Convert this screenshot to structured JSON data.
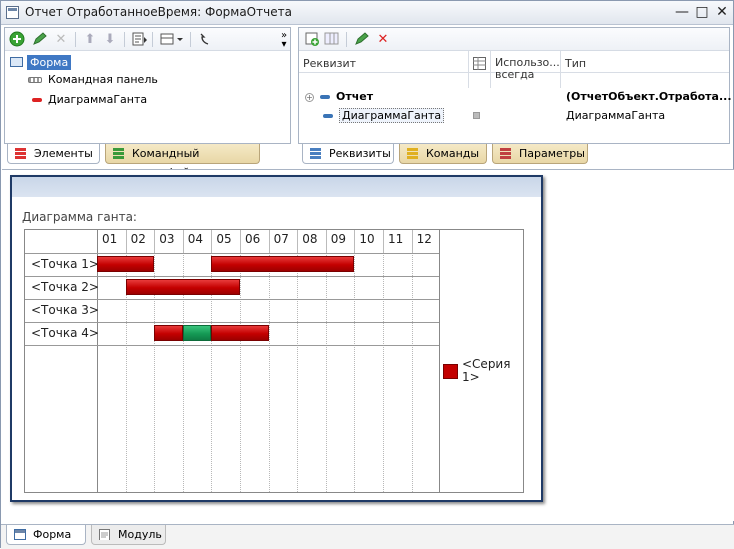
{
  "window": {
    "title": "Отчет ОтработанноеВремя: ФормаОтчета",
    "controls": {
      "minimize": "—",
      "maximize": "□",
      "close": "✕"
    }
  },
  "elements_panel": {
    "toolbar_icons": [
      "add-icon",
      "edit-icon",
      "delete-icon",
      "move-up-icon",
      "move-down-icon",
      "form-view-icon",
      "layout-dropdown-icon",
      "undo-icon",
      "more-icon"
    ],
    "tree": {
      "root": "Форма",
      "children": [
        "Командная панель",
        "ДиаграммаГанта"
      ]
    },
    "tabs": [
      "Элементы",
      "Командный интерфейс"
    ]
  },
  "attributes_panel": {
    "columns": {
      "attribute": "Реквизит",
      "use_always": "Использо... всегда",
      "type": "Тип"
    },
    "rows": [
      {
        "name": "Отчет",
        "type": "(ОтчетОбъект.Отработа..."
      },
      {
        "name": "ДиаграммаГанта",
        "type": "ДиаграммаГанта"
      }
    ],
    "tabs": [
      "Реквизиты",
      "Команды",
      "Параметры"
    ]
  },
  "preview": {
    "caption": "Диаграмма ганта:"
  },
  "chart_data": {
    "type": "gantt",
    "title": "Диаграмма ганта:",
    "periods": [
      "01",
      "02",
      "03",
      "04",
      "05",
      "06",
      "07",
      "08",
      "09",
      "10",
      "11",
      "12"
    ],
    "points": [
      "<Точка 1>",
      "<Точка 2>",
      "<Точка 3>",
      "<Точка 4>"
    ],
    "series": [
      {
        "name": "<Серия 1>",
        "color": "#c30000",
        "intervals": [
          {
            "point": "<Точка 1>",
            "start": 1,
            "end": 3,
            "color": "#c30000"
          },
          {
            "point": "<Точка 1>",
            "start": 5,
            "end": 10,
            "color": "#c30000"
          },
          {
            "point": "<Точка 2>",
            "start": 2,
            "end": 6,
            "color": "#c30000"
          },
          {
            "point": "<Точка 4>",
            "start": 3,
            "end": 4,
            "color": "#c30000"
          },
          {
            "point": "<Точка 4>",
            "start": 4,
            "end": 5,
            "color": "#159a55"
          },
          {
            "point": "<Точка 4>",
            "start": 5,
            "end": 7,
            "color": "#c30000"
          }
        ]
      }
    ],
    "legend": "right"
  },
  "bottom_tabs": [
    "Форма",
    "Модуль"
  ]
}
